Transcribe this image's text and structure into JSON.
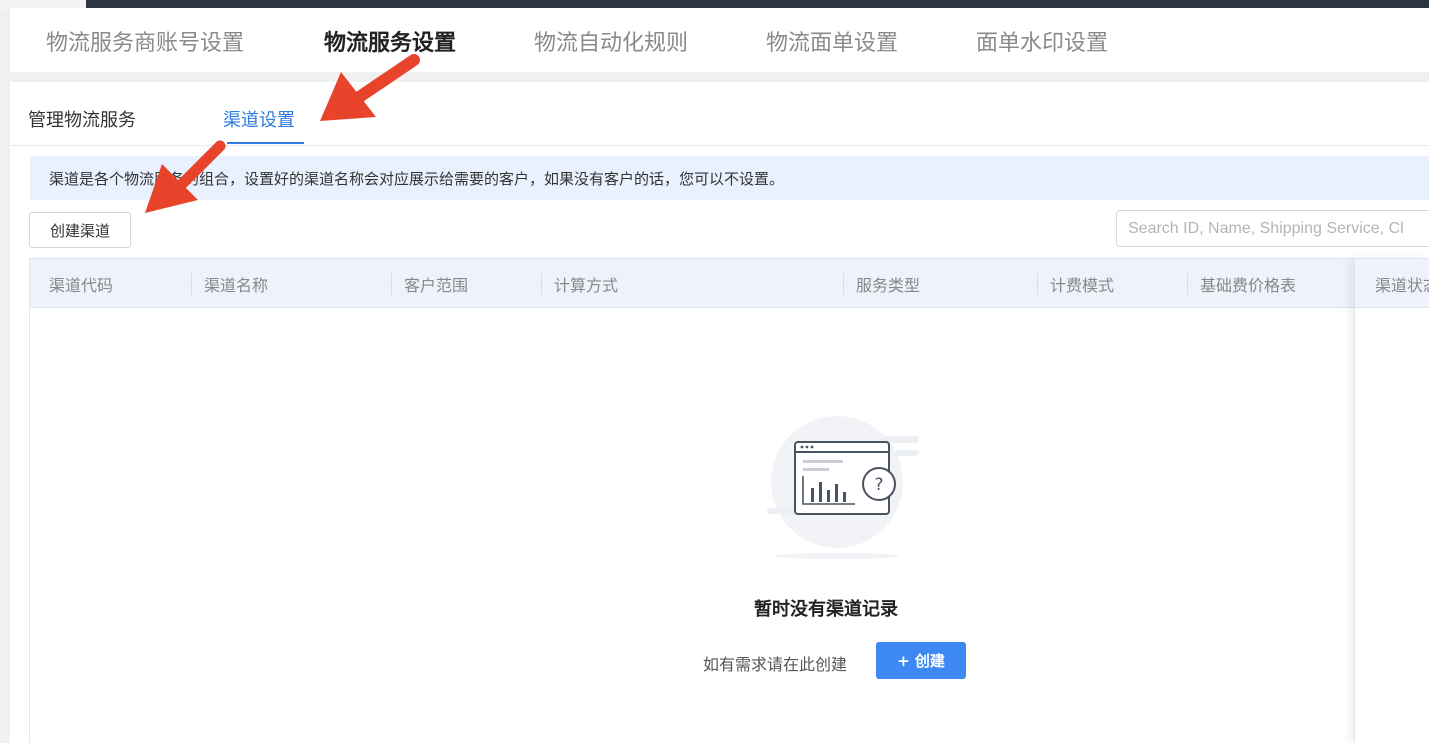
{
  "main_tabs": [
    {
      "label": "物流服务商账号设置",
      "active": false
    },
    {
      "label": "物流服务设置",
      "active": true
    },
    {
      "label": "物流自动化规则",
      "active": false
    },
    {
      "label": "物流面单设置",
      "active": false
    },
    {
      "label": "面单水印设置",
      "active": false
    }
  ],
  "sub_tabs": [
    {
      "label": "管理物流服务",
      "active": false
    },
    {
      "label": "渠道设置",
      "active": true
    }
  ],
  "info_banner": {
    "text": "渠道是各个物流服务的组合，设置好的渠道名称会对应展示给需要的客户，如果没有客户的话，您可以不设置。"
  },
  "toolbar": {
    "create_channel_label": "创建渠道",
    "search_placeholder": "Search ID, Name, Shipping Service, Cl"
  },
  "table": {
    "columns": [
      "渠道代码",
      "渠道名称",
      "客户范围",
      "计算方式",
      "服务类型",
      "计费模式",
      "基础费价格表",
      "渠道状态"
    ],
    "rows": []
  },
  "empty_state": {
    "title": "暂时没有渠道记录",
    "hint": "如有需求请在此创建",
    "button_label": "+ 创建"
  },
  "colors": {
    "accent": "#2f7de1",
    "primary_button": "#3d88f2",
    "banner_bg": "#e8f1fd",
    "table_header_bg": "#edf2fb",
    "annotation_arrow": "#e8442b"
  },
  "annotations": [
    {
      "type": "arrow",
      "points_to": "tab-channel-settings"
    },
    {
      "type": "arrow",
      "points_to": "create-channel-button"
    }
  ]
}
